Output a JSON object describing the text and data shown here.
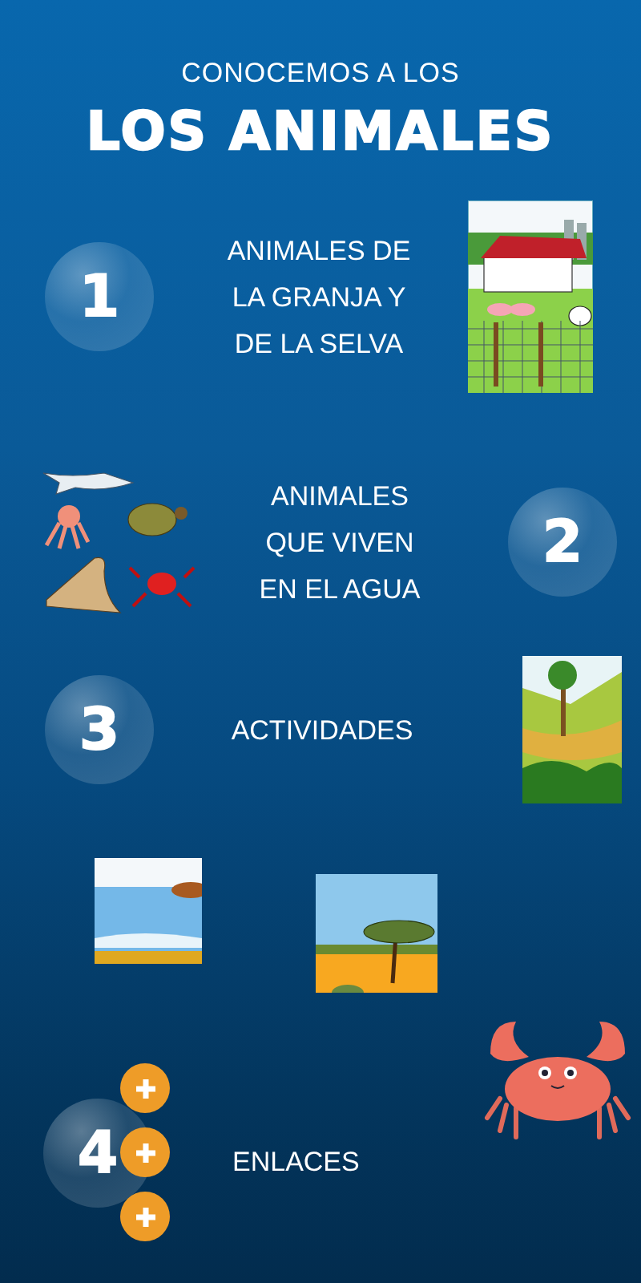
{
  "subtitle": "CONOCEMOS A LOS",
  "title": "LOS ANIMALES",
  "sections": [
    {
      "number": "1",
      "label_lines": [
        "ANIMALES DE",
        "LA GRANJA Y",
        "DE LA SELVA"
      ],
      "picture": {
        "kind": "farm"
      }
    },
    {
      "number": "2",
      "label_lines": [
        "ANIMALES",
        "QUE VIVEN",
        "EN EL AGUA"
      ],
      "picture": {
        "kind": "sea-animals"
      }
    },
    {
      "number": "3",
      "label_lines": [
        "ACTIVIDADES"
      ],
      "picture": {
        "kind": "jungle"
      }
    }
  ],
  "illustrations": [
    {
      "kind": "beach"
    },
    {
      "kind": "savanna"
    }
  ],
  "links_section": {
    "number": "4",
    "label": "ENLACES",
    "buttons": [
      {
        "kind": "plus"
      },
      {
        "kind": "plus"
      },
      {
        "kind": "plus"
      }
    ],
    "decoration": {
      "kind": "crab"
    }
  }
}
